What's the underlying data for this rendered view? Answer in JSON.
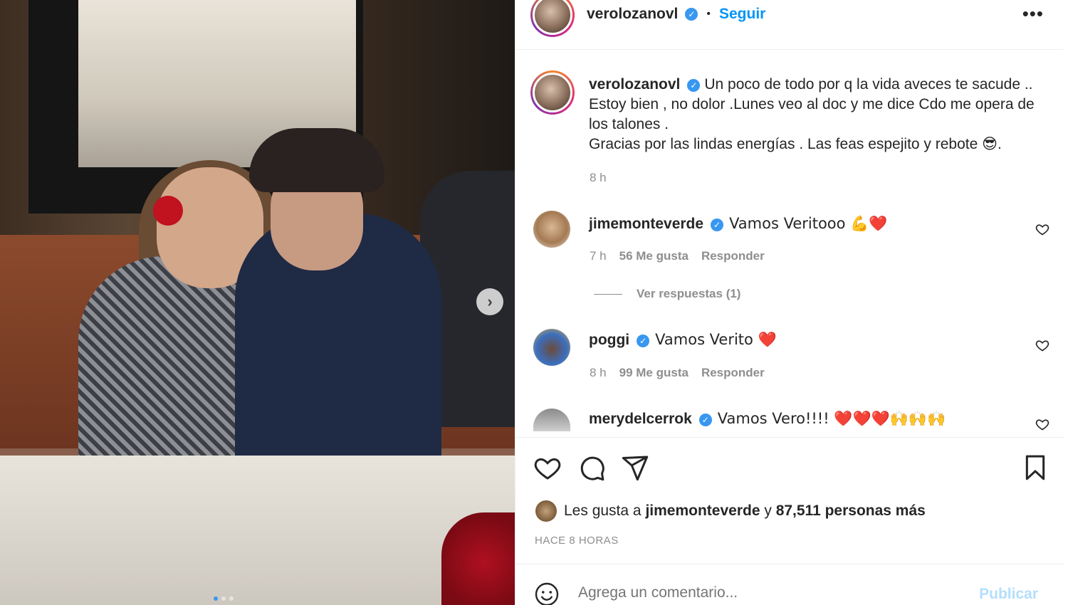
{
  "post": {
    "author": "verolozanovl",
    "follow_label": "Seguir",
    "separator": "•",
    "more_label": "•••",
    "caption_lines": [
      "Un poco de todo por q la vida aveces te sacude ..",
      "Estoy bien , no dolor .Lunes veo al doc y me dice Cdo me opera de",
      "los talones .",
      "Gracias por las lindas energías . Las feas espejito y rebote 😎."
    ],
    "caption_time": "8 h",
    "next_label": "›"
  },
  "comments": [
    {
      "user": "jimemonteverde",
      "text": "Vamos Veritooo 💪❤️",
      "time": "7 h",
      "likes": "56 Me gusta",
      "reply": "Responder",
      "view_replies": "Ver respuestas (1)"
    },
    {
      "user": "poggi",
      "text": "Vamos Verito ❤️",
      "time": "8 h",
      "likes": "99 Me gusta",
      "reply": "Responder"
    },
    {
      "user": "merydelcerrok",
      "text": "Vamos Vero!!!! ❤️❤️❤️🙌🙌🙌"
    }
  ],
  "likes_summary": {
    "prefix": "Les gusta a",
    "user": "jimemonteverde",
    "connector": "y",
    "rest": "87,511 personas más"
  },
  "posted_ago": "HACE 8 HORAS",
  "comment_box": {
    "placeholder": "Agrega un comentario...",
    "publish_label": "Publicar"
  },
  "icons": {
    "like": "heart-icon",
    "comment": "comment-icon",
    "share": "share-icon",
    "save": "bookmark-icon",
    "emoji": "smile-icon",
    "verified": "verified-badge-icon"
  },
  "colors": {
    "link": "#0095f6",
    "verified": "#3897f0",
    "muted": "#8e8e8e",
    "heart": "#e0245e",
    "publish_disabled": "#b2dffc"
  }
}
